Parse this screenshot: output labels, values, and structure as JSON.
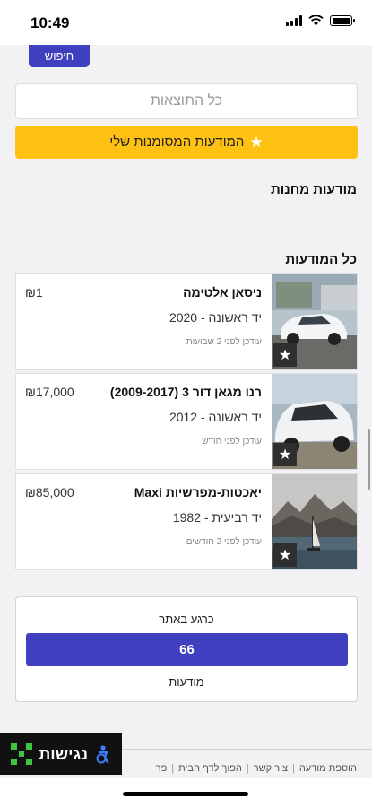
{
  "status_bar": {
    "time": "10:49"
  },
  "search_button": {
    "label": "חיפוש"
  },
  "all_results": {
    "label": "כל התוצאות"
  },
  "my_ads": {
    "label": "המודעות המסומנות שלי"
  },
  "sections": {
    "store_ads": "מודעות מחנות",
    "all_ads": "כל המודעות"
  },
  "listings": [
    {
      "title": "ניסאן אלטימה",
      "subtitle": "יד ראשונה - 2020",
      "updated": "עודכן לפני 2 שבועות",
      "price": "₪1"
    },
    {
      "title": "רנו מגאן דור 3 (2009-2017)",
      "subtitle": "יד ראשונה - 2012",
      "updated": "עודכן לפני חודש",
      "price": "₪17,000"
    },
    {
      "title": "יאכטות-מפרשיות Maxi",
      "subtitle": "יד רביעית - 1982",
      "updated": "עודכן לפני 2 חודשים",
      "price": "₪85,000"
    }
  ],
  "stats": {
    "top": "כרגע באתר",
    "count": "66",
    "bottom": "מודעות"
  },
  "footer": {
    "links": [
      "הוספת מודעה",
      "צור קשר",
      "הפוך לדף הבית",
      "פר"
    ]
  },
  "accessibility": {
    "label": "נגישות"
  },
  "colors": {
    "primary": "#3f3fbf",
    "accent": "#ffc213"
  }
}
